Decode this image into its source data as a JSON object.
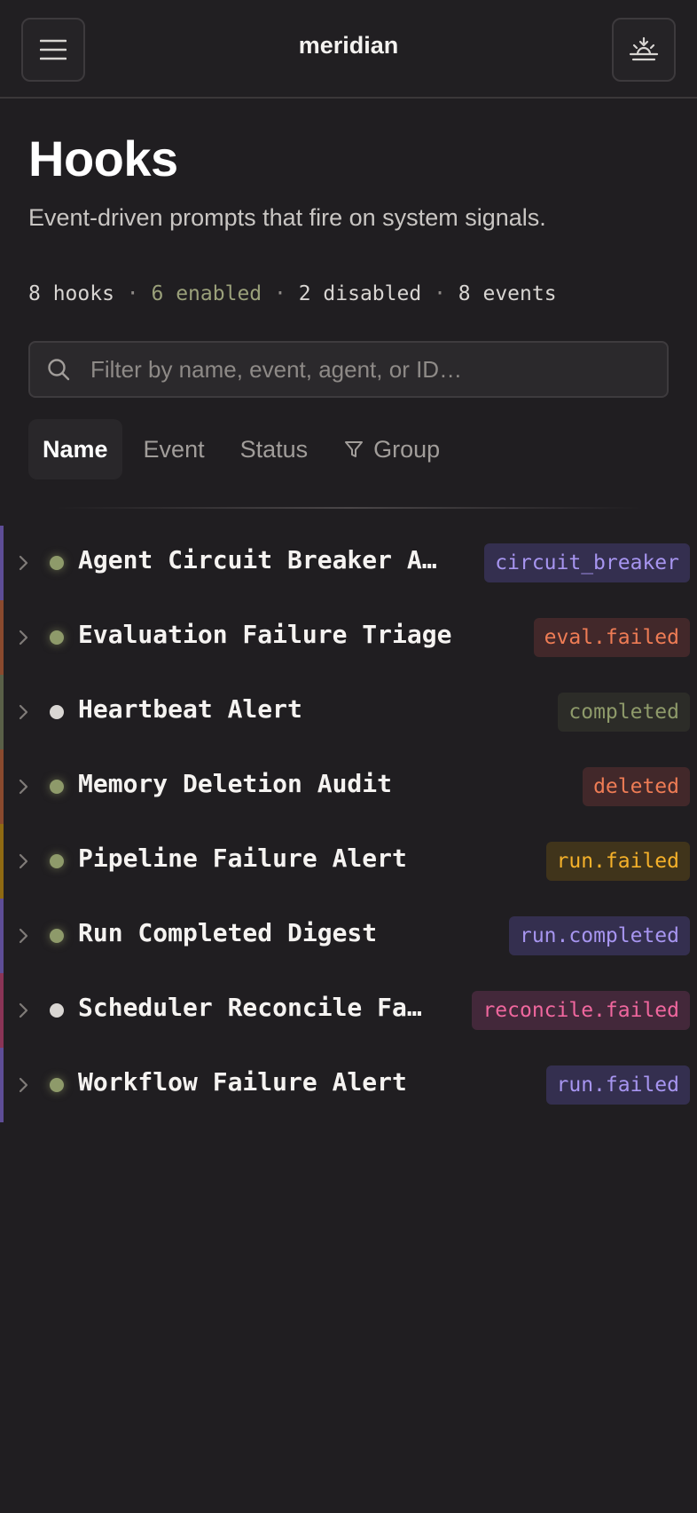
{
  "app": {
    "title": "meridian"
  },
  "header": {
    "menu_icon": "hamburger-icon",
    "action_icon": "sunrise-icon"
  },
  "page": {
    "title": "Hooks",
    "subtitle": "Event-driven prompts that fire on system signals."
  },
  "stats": {
    "hooks": "8 hooks",
    "enabled": "6 enabled",
    "disabled": "2 disabled",
    "events": "8 events",
    "separator": "·"
  },
  "search": {
    "placeholder": "Filter by name, event, agent, or ID…",
    "value": ""
  },
  "tabs": [
    {
      "label": "Name",
      "active": true
    },
    {
      "label": "Event",
      "active": false
    },
    {
      "label": "Status",
      "active": false
    },
    {
      "label": "Group",
      "active": false,
      "icon": "filter-icon"
    }
  ],
  "hooks": [
    {
      "name": "Agent Circuit Breaker A…",
      "event": "circuit_breaker",
      "enabled": true,
      "accent": "#5e4d96",
      "badge_bg": "#342f4f",
      "badge_fg": "#a795f0"
    },
    {
      "name": "Evaluation Failure Triage",
      "event": "eval.failed",
      "enabled": true,
      "accent": "#8a4a2e",
      "badge_bg": "#42282a",
      "badge_fg": "#ee7c55"
    },
    {
      "name": "Heartbeat Alert",
      "event": "completed",
      "enabled": false,
      "accent": "#5a6048",
      "badge_bg": "#2c2c28",
      "badge_fg": "#8e9a6a"
    },
    {
      "name": "Memory Deletion Audit",
      "event": "deleted",
      "enabled": true,
      "accent": "#8a4a2e",
      "badge_bg": "#42282a",
      "badge_fg": "#ee7c55"
    },
    {
      "name": "Pipeline Failure Alert",
      "event": "run.failed",
      "enabled": true,
      "accent": "#8f6a12",
      "badge_bg": "#40341b",
      "badge_fg": "#f5b12a"
    },
    {
      "name": "Run Completed Digest",
      "event": "run.completed",
      "enabled": true,
      "accent": "#5e4d96",
      "badge_bg": "#342f4f",
      "badge_fg": "#a795f0"
    },
    {
      "name": "Scheduler Reconcile Fa…",
      "event": "reconcile.failed",
      "enabled": false,
      "accent": "#8a3456",
      "badge_bg": "#43283a",
      "badge_fg": "#f0679e"
    },
    {
      "name": "Workflow Failure Alert",
      "event": "run.failed",
      "enabled": true,
      "accent": "#5e4d96",
      "badge_bg": "#342f4f",
      "badge_fg": "#a795f0"
    }
  ]
}
